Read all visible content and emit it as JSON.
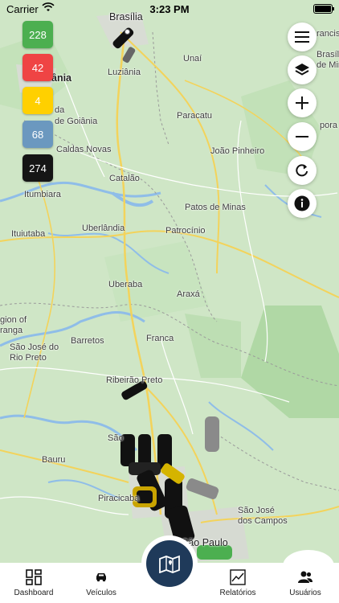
{
  "status_bar": {
    "carrier": "Carrier",
    "time": "3:23 PM"
  },
  "counters": [
    {
      "value": "228",
      "color": "#4caf50"
    },
    {
      "value": "42",
      "color": "#ef4444"
    },
    {
      "value": "4",
      "color": "#ffd000"
    },
    {
      "value": "68",
      "color": "#6b98bf"
    },
    {
      "value": "274",
      "color": "#151515"
    }
  ],
  "map_controls": [
    {
      "name": "menu-icon"
    },
    {
      "name": "layers-icon"
    },
    {
      "name": "zoom-in-icon"
    },
    {
      "name": "zoom-out-icon"
    },
    {
      "name": "refresh-icon"
    },
    {
      "name": "info-icon"
    }
  ],
  "cities": {
    "brasilia": "Brasília",
    "luziania": "Luziânia",
    "unai": "Unaí",
    "goiania_partial": "ânia",
    "aparecida_partial": "da",
    "aparecida_partial2": "de Goiânia",
    "paracatu": "Paracatu",
    "joao_pinheiro": "João Pinheiro",
    "caldas_novas": "Caldas Novas",
    "catalao": "Catalão",
    "itumbiara": "Itumbiara",
    "patos_de_minas": "Patos de Minas",
    "ituiutaba": "Ituiutaba",
    "uberlandia": "Uberlândia",
    "patrocinio": "Patrocínio",
    "uberaba": "Uberaba",
    "araxa": "Araxá",
    "barretos": "Barretos",
    "franca": "Franca",
    "sao_jose_rio_preto": "São José do\nRio Preto",
    "ribeirao_preto": "Ribeirão Preto",
    "sao_carlos_partial": "São",
    "bauru": "Bauru",
    "piracicaba": "Piracicaba",
    "sao_jose_campos": "São José\ndos Campos",
    "sao_paulo": "São Paulo",
    "francis_partial": "rancis",
    "brasilia_mina_partial": "Brasília\nde Mina",
    "pirapora_partial": "pora",
    "region_partial": "gion of",
    "laranja_partial": "ranga"
  },
  "bottom_nav": {
    "dashboard": "Dashboard",
    "veiculos": "Veículos",
    "relatorios": "Relatórios",
    "usuarios": "Usuários"
  }
}
